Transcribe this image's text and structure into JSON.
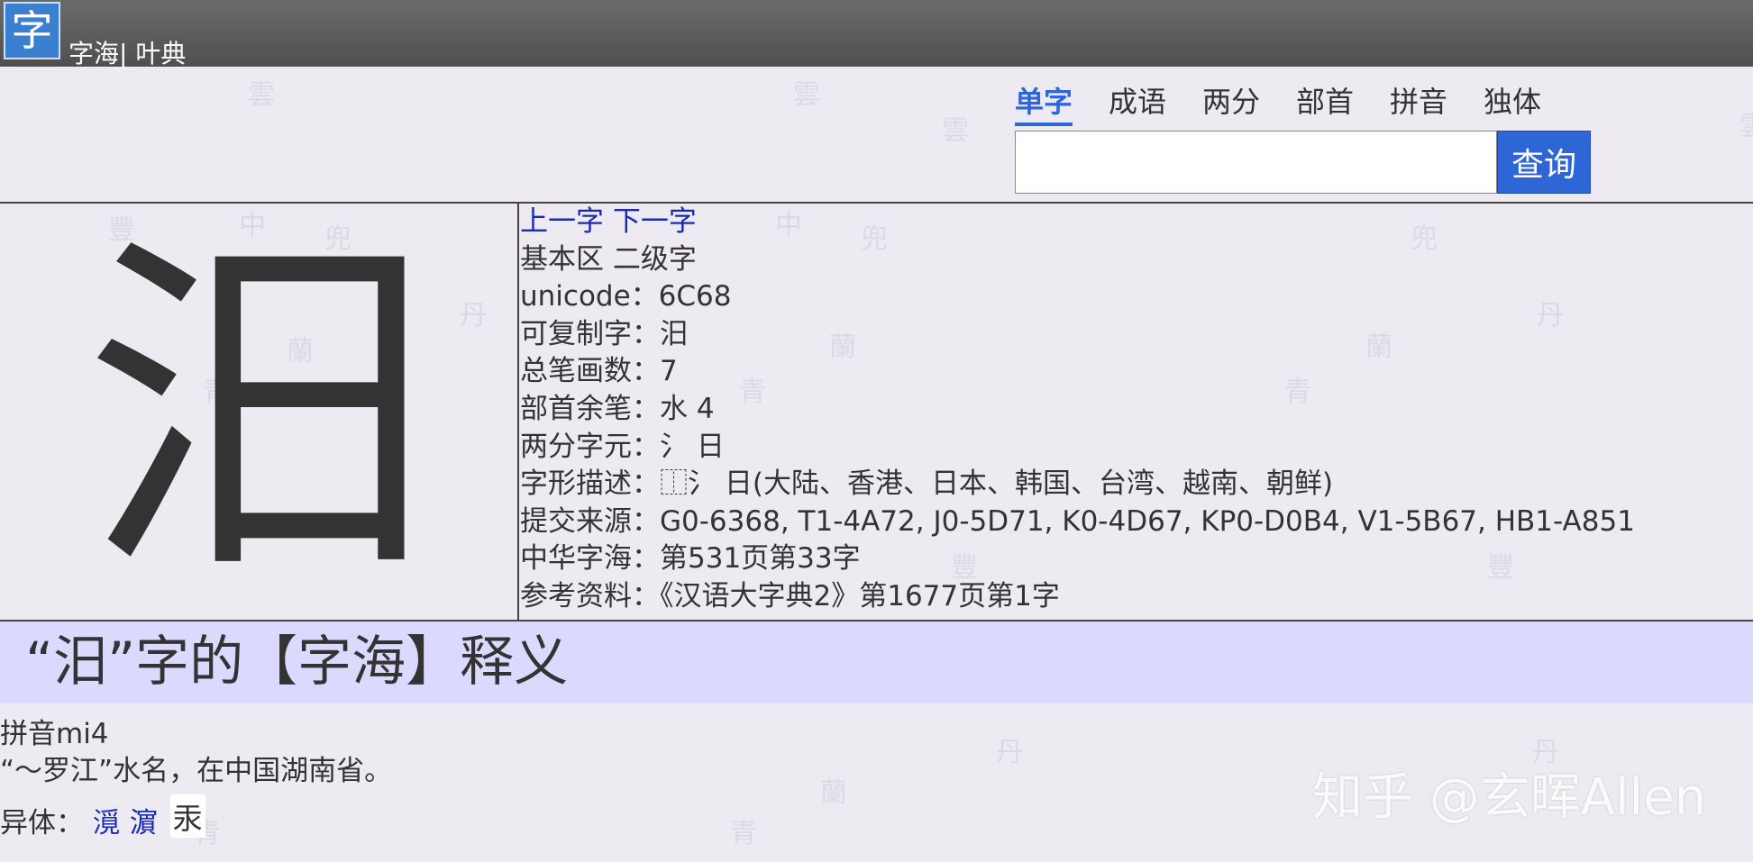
{
  "header": {
    "logo_char": "字",
    "site_title": "字海| 叶典"
  },
  "nav": {
    "tabs": [
      {
        "label": "单字",
        "active": true
      },
      {
        "label": "成语",
        "active": false
      },
      {
        "label": "两分",
        "active": false
      },
      {
        "label": "部首",
        "active": false
      },
      {
        "label": "拼音",
        "active": false
      },
      {
        "label": "独体",
        "active": false
      }
    ]
  },
  "search": {
    "value": "",
    "placeholder": "",
    "button_label": "查询"
  },
  "character": {
    "glyph": "汨",
    "prev_link": "上一字",
    "next_link": "下一字",
    "block_level": "基本区 二级字",
    "unicode": "unicode：6C68",
    "copyable": "可复制字：汨",
    "stroke_count": "总笔画数：7",
    "radical_strokes": "部首余笔：水 4",
    "components": "两分字元：氵 日",
    "glyph_desc": "字形描述：⿰氵 日(大陆、香港、日本、韩国、台湾、越南、朝鲜)",
    "sources": "提交来源：G0-6368, T1-4A72, J0-5D71, K0-4D67, KP0-D0B4, V1-5B67, HB1-A851",
    "zhonghua": "中华字海：第531页第33字",
    "reference": "参考资料：《汉语大字典2》第1677页第1字"
  },
  "definition": {
    "heading": "“汨”字的【字海】释义",
    "pinyin": "拼音mi4",
    "text": "“～罗江”水名，在中国湖南省。",
    "variants_label": "异体：",
    "variants": [
      "漞",
      "濵"
    ],
    "variant_boxed": "汞"
  },
  "watermark": "知乎 @玄晖Allen",
  "colors": {
    "accent": "#2f66d6",
    "link": "#1a2bb0",
    "band": "#dcd9ff"
  }
}
